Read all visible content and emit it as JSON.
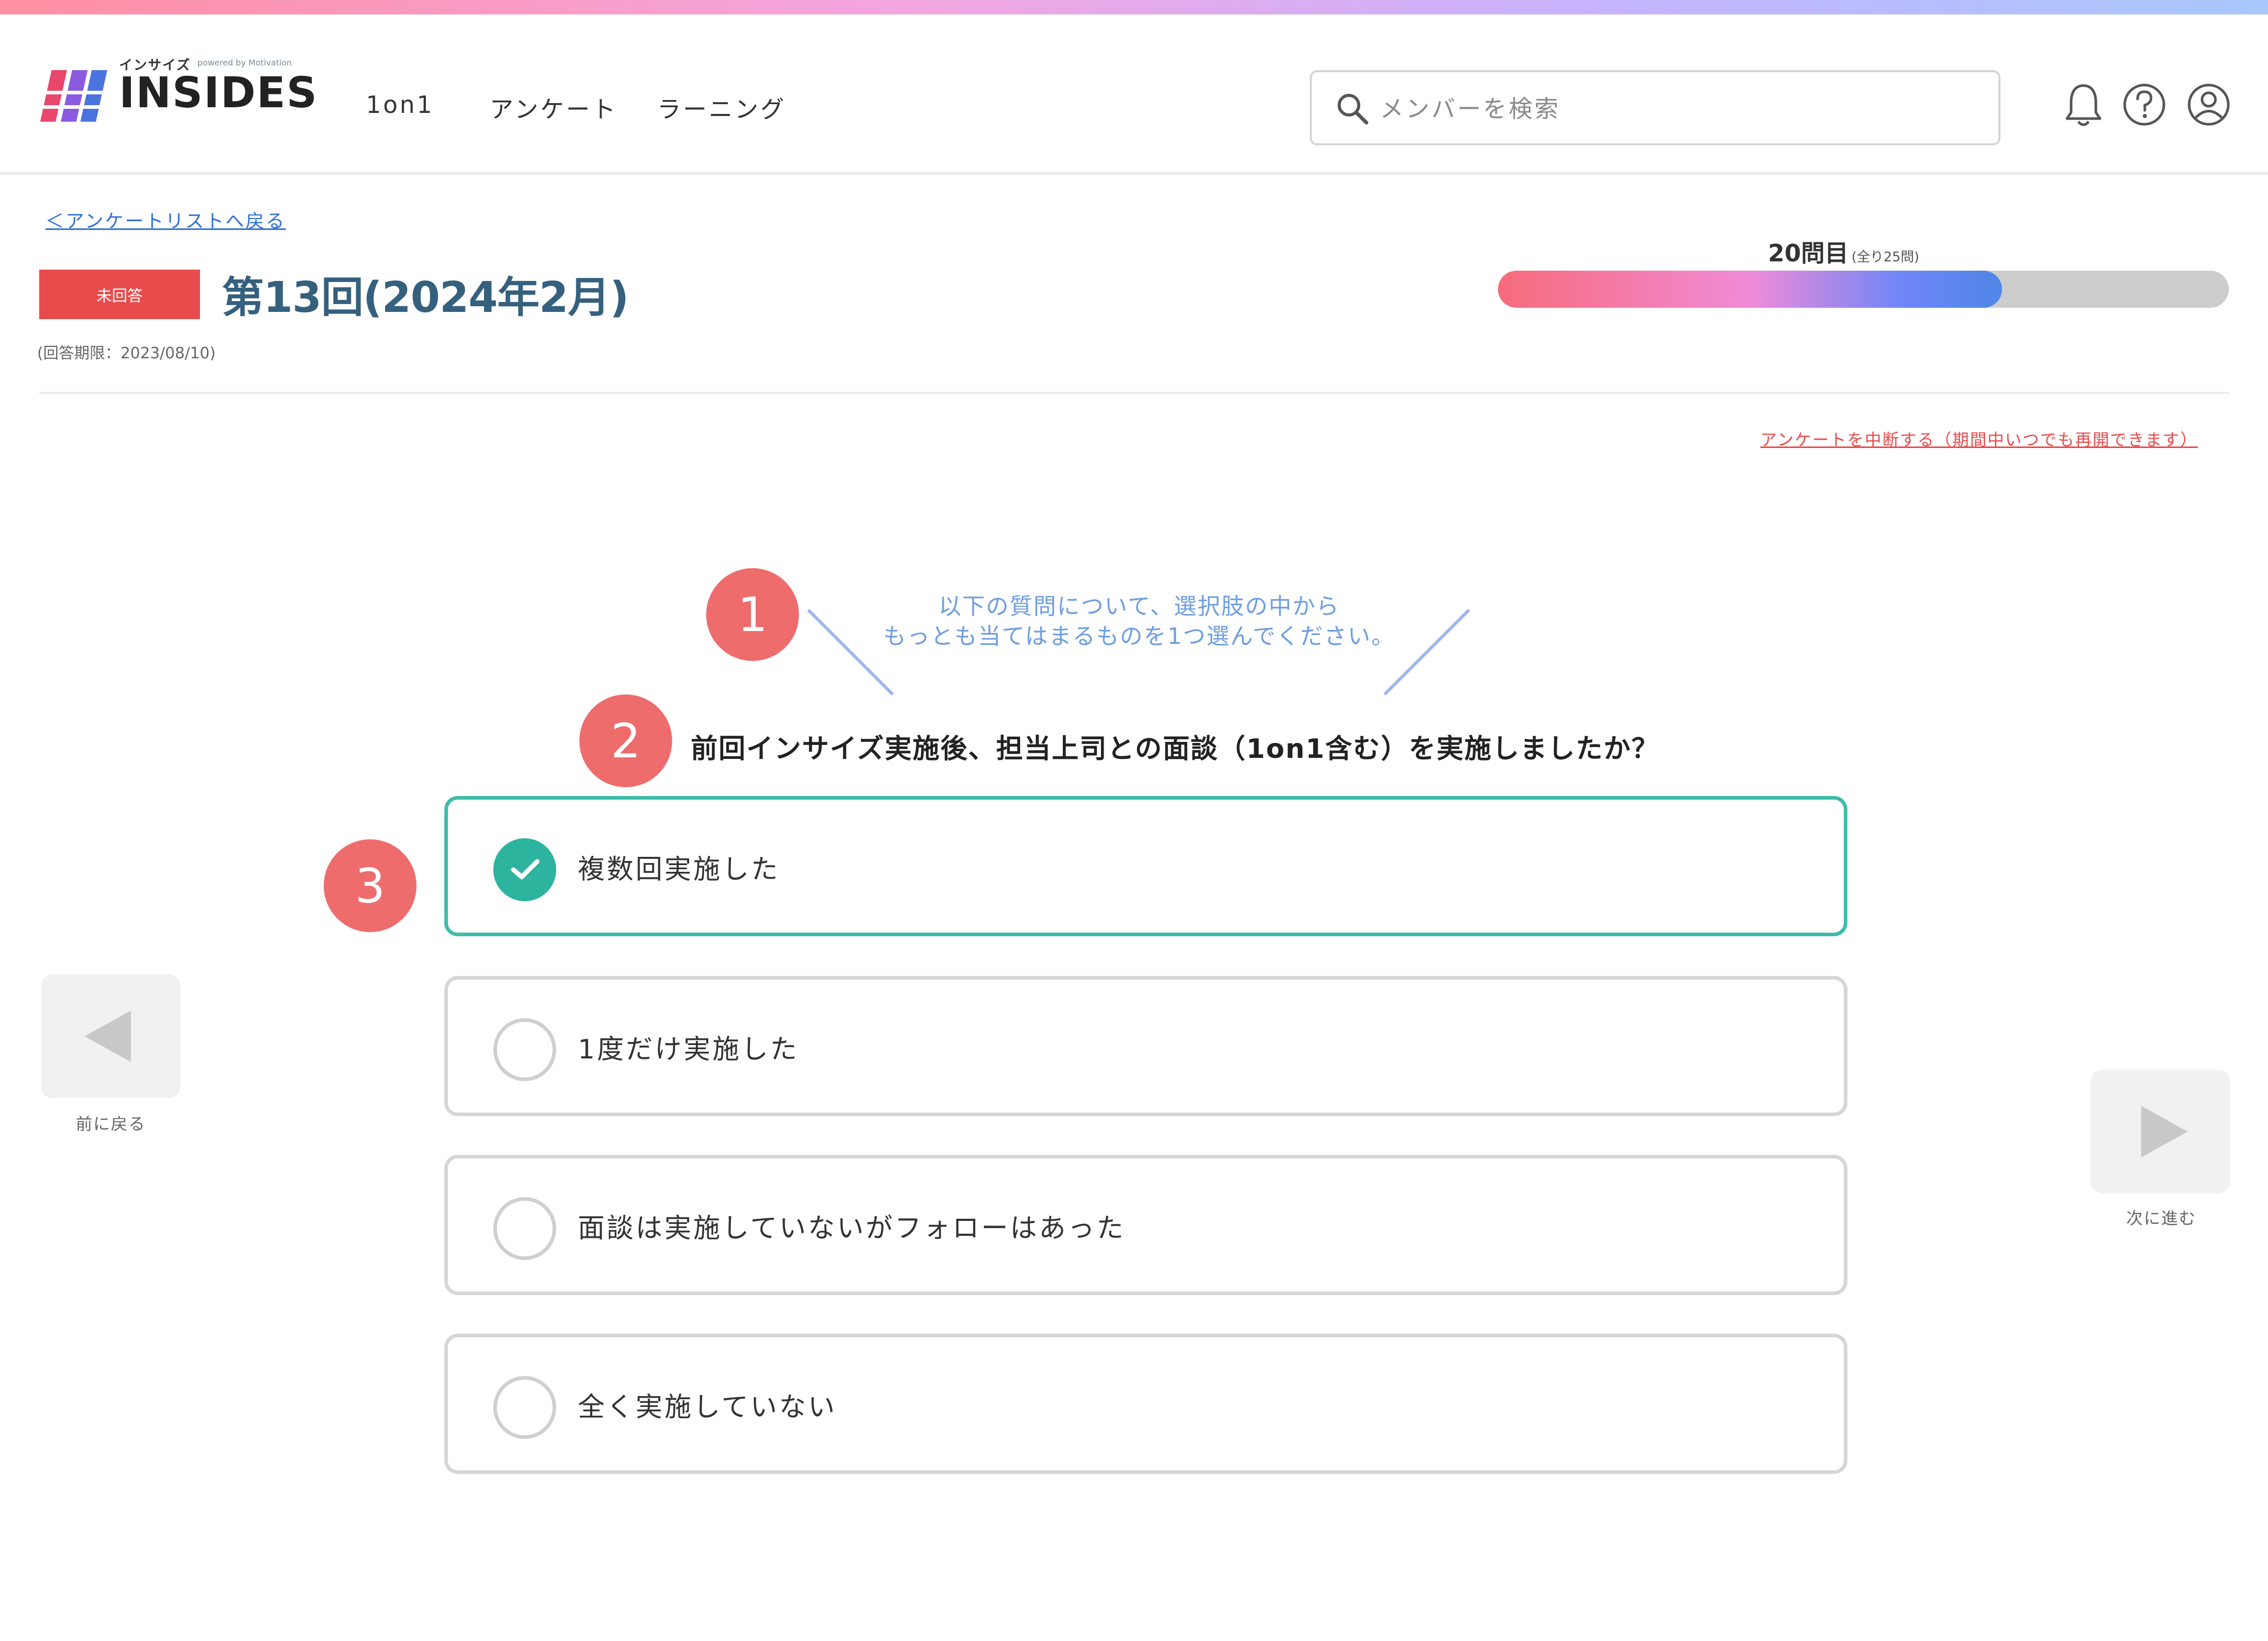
{
  "header": {
    "logo_small": "インサイズ",
    "logo_small2": "powered by Motivation",
    "logo_text": "INSIDES",
    "nav": [
      "1on1",
      "アンケート",
      "ラーニング"
    ],
    "search_placeholder": "メンバーを検索",
    "icons": [
      "bell-icon",
      "help-icon",
      "user-icon"
    ]
  },
  "survey": {
    "back_link": "＜アンケートリストへ戻る",
    "status_badge": "未回答",
    "title": "第13回(2024年2月)",
    "deadline": "(回答期限：2023/08/10)",
    "progress_label": "20問目",
    "progress_sub": "(全り25問)",
    "progress_fraction": 0.69,
    "pause_link": "アンケートを中断する（期間中いつでも再開できます）"
  },
  "content": {
    "instruction_line1": "以下の質問について、選択肢の中から",
    "instruction_line2": "もっとも当てはまるものを1つ選んでください。",
    "question": "前回インサイズ実施後、担当上司との面談（1on1含む）を実施しましたか？",
    "options": [
      {
        "label": "複数回実施した",
        "selected": true
      },
      {
        "label": "1度だけ実施した",
        "selected": false
      },
      {
        "label": "面談は実施していないがフォローはあった",
        "selected": false
      },
      {
        "label": "全く実施していない",
        "selected": false
      }
    ],
    "prev_label": "前に戻る",
    "next_label": "次に進む"
  },
  "annotations": [
    "1",
    "2",
    "3"
  ],
  "colors": {
    "accent_teal": "#2cb49f",
    "badge_red": "#e84b4b",
    "annotation_red": "#ee6c6c",
    "title_blue": "#35607e",
    "instruction_blue": "#6f9ee0"
  }
}
